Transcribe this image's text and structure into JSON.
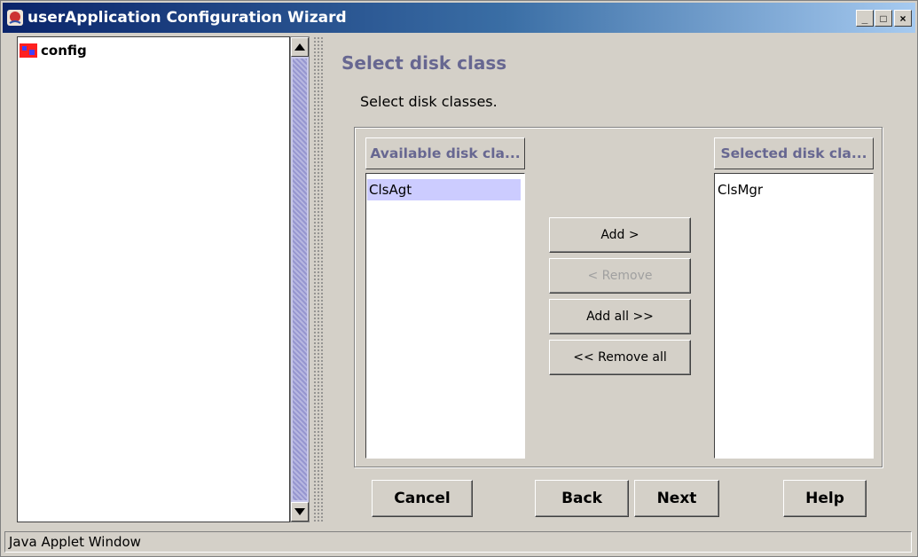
{
  "window": {
    "title": "userApplication Configuration Wizard",
    "controls": {
      "minimize": "_",
      "maximize": "□",
      "close": "×"
    }
  },
  "tree": {
    "root_label": "config"
  },
  "panel": {
    "title": "Select disk class",
    "instructions": "Select disk classes."
  },
  "available": {
    "header": "Available disk cla...",
    "items": [
      {
        "label": "ClsAgt",
        "selected": true
      }
    ]
  },
  "selected": {
    "header": "Selected disk cla...",
    "items": [
      {
        "label": "ClsMgr",
        "selected": false
      }
    ]
  },
  "transfer_buttons": {
    "add": "Add >",
    "remove": "< Remove",
    "add_all": "Add all >>",
    "remove_all": "<< Remove all"
  },
  "footer_buttons": {
    "cancel": "Cancel",
    "back": "Back",
    "next": "Next",
    "help": "Help"
  },
  "status_bar": "Java Applet Window",
  "colors": {
    "accent": "#676791",
    "selection": "#ccccff",
    "scroll": "#c8c8ea"
  }
}
